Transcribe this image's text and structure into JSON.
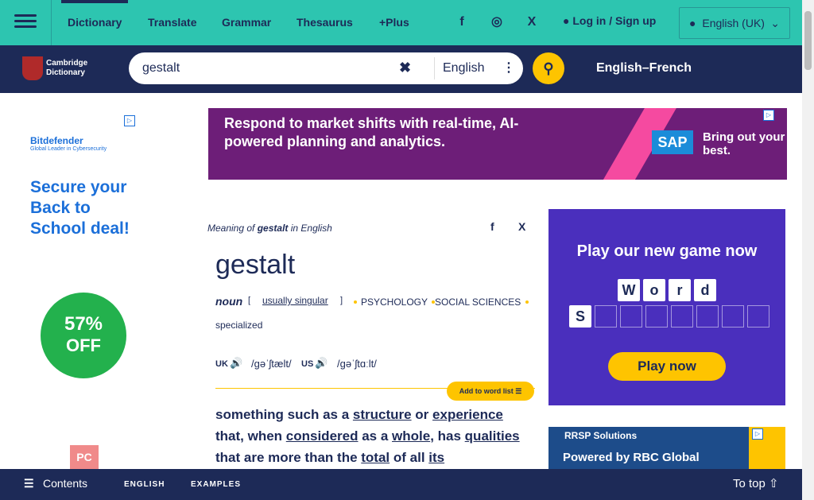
{
  "topbar": {
    "menu_label": "",
    "tabs": [
      "Dictionary",
      "Translate",
      "Grammar",
      "Thesaurus",
      "+Plus"
    ],
    "social": {
      "facebook": "f",
      "instagram": "◎",
      "x": "X"
    },
    "login": "Log in",
    "slash": "/",
    "signup": "Sign up",
    "language": "English (UK)"
  },
  "navbar": {
    "logo_line1": "Cambridge",
    "logo_line2": "Dictionary",
    "search_value": "gestalt",
    "search_dict": "English",
    "translate_pair": "English–French"
  },
  "left_ad": {
    "brand": "Bitdefender",
    "brand_sub": "Global Leader in Cybersecurity",
    "headline": "Secure your Back to School deal!",
    "percent": "57%",
    "off": "OFF",
    "badge": "PC"
  },
  "top_ad": {
    "text": "Respond to market shifts with real-time, AI-powered planning and analytics.",
    "logo": "SAP",
    "tagline": "Bring out your best."
  },
  "entry": {
    "meaning_prefix": "Meaning of",
    "meaning_word": "gestalt",
    "meaning_suffix": "in English",
    "headword": "gestalt",
    "pos": "noun",
    "grammar": "usually singular",
    "labels": [
      "PSYCHOLOGY",
      "SOCIAL SCIENCES"
    ],
    "register": "specialized",
    "uk_label": "UK",
    "uk_ipa": "/ɡəˈʃtælt/",
    "us_label": "US",
    "us_ipa": "/ɡəˈʃtɑːlt/",
    "add_to_list": "Add to word list",
    "def_parts": {
      "p1": "something such as a ",
      "w1": "structure",
      "p2": " or ",
      "w2": "experience",
      "p3": " that, when ",
      "w3": "considered",
      "p4": " as a ",
      "w4": "whole",
      "p5": ", has ",
      "w5": "qualities",
      "p6": " that are more than the ",
      "w6": "total",
      "p7": " of all ",
      "w7": "its"
    }
  },
  "game_ad": {
    "title": "Play our new game now",
    "word": [
      "W",
      "o",
      "r",
      "d"
    ],
    "start_letter": "S",
    "cta": "Play now"
  },
  "rbc_ad": {
    "tag": "RRSP Solutions",
    "text": "Powered by RBC Global"
  },
  "bottombar": {
    "contents": "Contents",
    "tab_english": "ENGLISH",
    "tab_examples": "EXAMPLES",
    "to_top": "To top"
  }
}
